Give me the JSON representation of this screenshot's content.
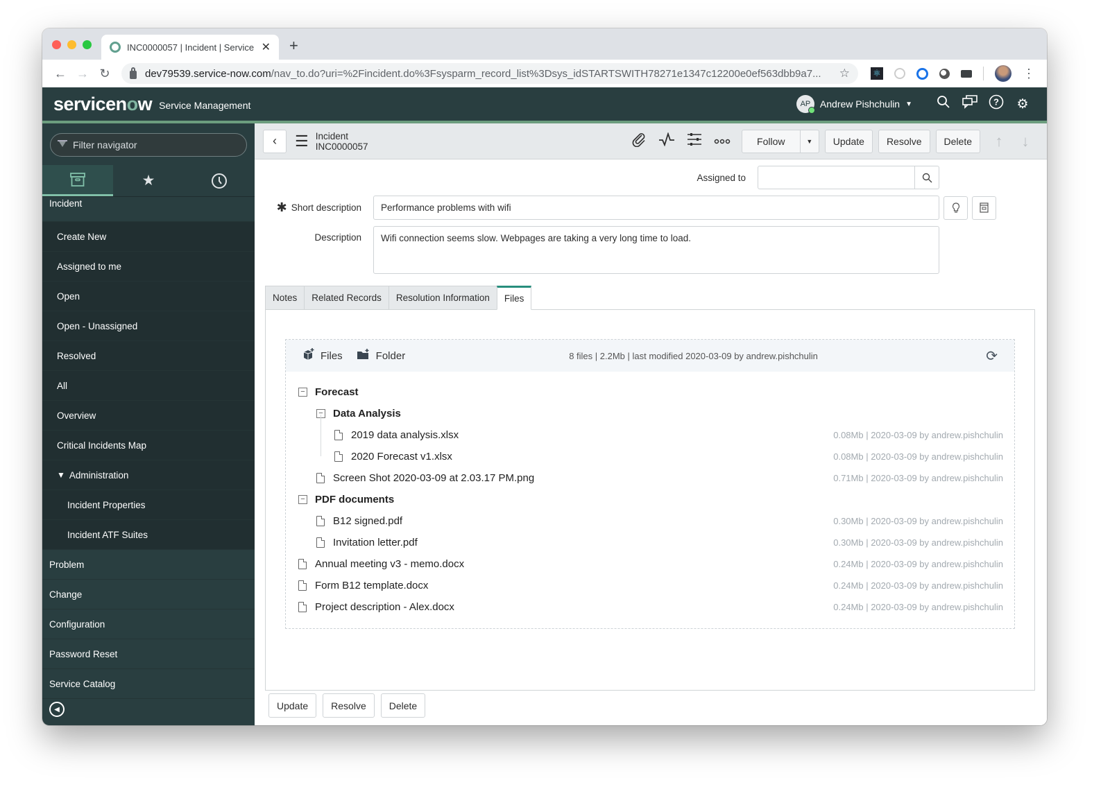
{
  "browser": {
    "tab_title": "INC0000057 | Incident | Service",
    "new_tab_icon": "plus-icon",
    "url_host": "dev79539.service-now.com",
    "url_path": "/nav_to.do?uri=%2Fincident.do%3Fsysparm_record_list%3Dsys_idSTARTSWITH78271e1347c12200e0ef563dbb9a7..."
  },
  "header": {
    "logo_text_before": "servicen",
    "logo_text_o": "o",
    "logo_text_after": "w",
    "subtitle": "Service Management",
    "user_initials": "AP",
    "user_name": "Andrew Pishchulin",
    "icons": [
      "search-icon",
      "chat-icon",
      "help-icon",
      "gear-icon"
    ]
  },
  "nav": {
    "filter_placeholder": "Filter navigator",
    "tabs": [
      "all-apps",
      "favorites",
      "history"
    ],
    "items": [
      {
        "label": "Incident",
        "level": 0,
        "head": true
      },
      {
        "label": "Create New",
        "level": 1
      },
      {
        "label": "Assigned to me",
        "level": 1
      },
      {
        "label": "Open",
        "level": 1
      },
      {
        "label": "Open - Unassigned",
        "level": 1
      },
      {
        "label": "Resolved",
        "level": 1
      },
      {
        "label": "All",
        "level": 1
      },
      {
        "label": "Overview",
        "level": 1
      },
      {
        "label": "Critical Incidents Map",
        "level": 1
      },
      {
        "label": "Administration",
        "level": 1,
        "expanded": true
      },
      {
        "label": "Incident Properties",
        "level": 2
      },
      {
        "label": "Incident ATF Suites",
        "level": 2
      },
      {
        "label": "Problem",
        "level": 0
      },
      {
        "label": "Change",
        "level": 0
      },
      {
        "label": "Configuration",
        "level": 0
      },
      {
        "label": "Password Reset",
        "level": 0
      },
      {
        "label": "Service Catalog",
        "level": 0
      }
    ]
  },
  "form": {
    "table": "Incident",
    "number": "INC0000057",
    "buttons": {
      "follow": "Follow",
      "update": "Update",
      "resolve": "Resolve",
      "delete": "Delete"
    },
    "assigned_to_label": "Assigned to",
    "assigned_to_value": "",
    "short_description_label": "Short description",
    "short_description_value": "Performance problems with wifi",
    "description_label": "Description",
    "description_value": "Wifi connection seems slow. Webpages are taking a very long time to load.",
    "tabs": [
      "Notes",
      "Related Records",
      "Resolution Information",
      "Files"
    ],
    "active_tab": "Files"
  },
  "files": {
    "add_files_label": "Files",
    "add_folder_label": "Folder",
    "summary": "8 files | 2.2Mb | last modified 2020-03-09 by andrew.pishchulin",
    "tree": [
      {
        "type": "folder",
        "name": "Forecast",
        "depth": 0
      },
      {
        "type": "folder",
        "name": "Data Analysis",
        "depth": 1
      },
      {
        "type": "file",
        "name": "2019 data analysis.xlsx",
        "depth": 2,
        "meta": "0.08Mb | 2020-03-09 by andrew.pishchulin"
      },
      {
        "type": "file",
        "name": "2020 Forecast v1.xlsx",
        "depth": 2,
        "meta": "0.08Mb | 2020-03-09 by andrew.pishchulin"
      },
      {
        "type": "file",
        "name": "Screen Shot 2020-03-09 at 2.03.17 PM.png",
        "depth": 1,
        "meta": "0.71Mb | 2020-03-09 by andrew.pishchulin"
      },
      {
        "type": "folder",
        "name": "PDF documents",
        "depth": 0
      },
      {
        "type": "file",
        "name": "B12 signed.pdf",
        "depth": 1,
        "meta": "0.30Mb | 2020-03-09 by andrew.pishchulin"
      },
      {
        "type": "file",
        "name": "Invitation letter.pdf",
        "depth": 1,
        "meta": "0.30Mb | 2020-03-09 by andrew.pishchulin"
      },
      {
        "type": "file",
        "name": "Annual meeting v3 - memo.docx",
        "depth": 0,
        "meta": "0.24Mb | 2020-03-09 by andrew.pishchulin"
      },
      {
        "type": "file",
        "name": "Form B12 template.docx",
        "depth": 0,
        "meta": "0.24Mb | 2020-03-09 by andrew.pishchulin"
      },
      {
        "type": "file",
        "name": "Project description - Alex.docx",
        "depth": 0,
        "meta": "0.24Mb | 2020-03-09 by andrew.pishchulin"
      }
    ]
  },
  "colors": {
    "header_bg": "#293e40",
    "accent": "#81b5a1",
    "active_tab_border": "#278e7c"
  }
}
